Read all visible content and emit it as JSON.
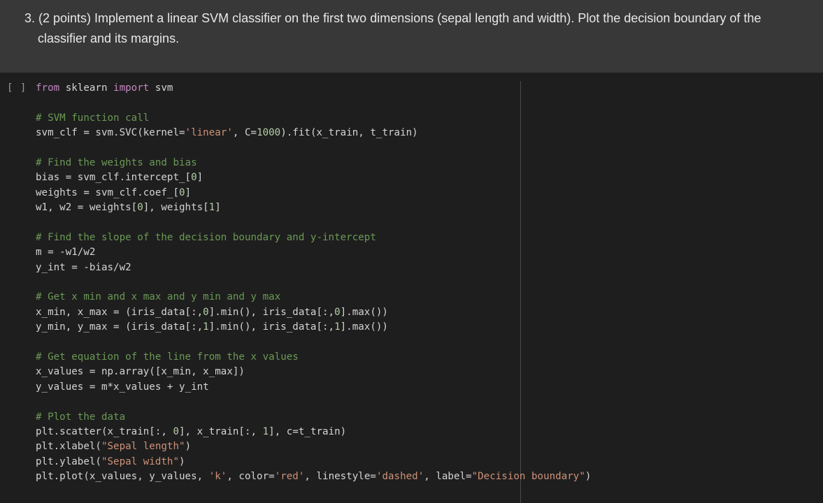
{
  "markdown": {
    "lines": [
      "3. (2 points) Implement a linear SVM classifier on the first two dimensions (sepal length and width). Plot the decision boundary of the",
      "classifier and its margins."
    ]
  },
  "code_cell": {
    "run_indicator": "[ ]",
    "lines": [
      [
        {
          "t": "kw",
          "s": "from"
        },
        {
          "t": "pl",
          "s": " sklearn "
        },
        {
          "t": "kw",
          "s": "import"
        },
        {
          "t": "pl",
          "s": " svm"
        }
      ],
      [],
      [
        {
          "t": "cm",
          "s": "# SVM function call"
        }
      ],
      [
        {
          "t": "pl",
          "s": "svm_clf = svm.SVC(kernel="
        },
        {
          "t": "st",
          "s": "'linear'"
        },
        {
          "t": "pl",
          "s": ", C="
        },
        {
          "t": "nm",
          "s": "1000"
        },
        {
          "t": "pl",
          "s": ").fit(x_train, t_train)"
        }
      ],
      [],
      [
        {
          "t": "cm",
          "s": "# Find the weights and bias"
        }
      ],
      [
        {
          "t": "pl",
          "s": "bias = svm_clf.intercept_["
        },
        {
          "t": "nm",
          "s": "0"
        },
        {
          "t": "pl",
          "s": "]"
        }
      ],
      [
        {
          "t": "pl",
          "s": "weights = svm_clf.coef_["
        },
        {
          "t": "nm",
          "s": "0"
        },
        {
          "t": "pl",
          "s": "]"
        }
      ],
      [
        {
          "t": "pl",
          "s": "w1, w2 = weights["
        },
        {
          "t": "nm",
          "s": "0"
        },
        {
          "t": "pl",
          "s": "], weights["
        },
        {
          "t": "nm",
          "s": "1"
        },
        {
          "t": "pl",
          "s": "]"
        }
      ],
      [],
      [
        {
          "t": "cm",
          "s": "# Find the slope of the decision boundary and y-intercept"
        }
      ],
      [
        {
          "t": "pl",
          "s": "m = -w1/w2"
        }
      ],
      [
        {
          "t": "pl",
          "s": "y_int = -bias/w2"
        }
      ],
      [],
      [
        {
          "t": "cm",
          "s": "# Get x min and x max and y min and y max"
        }
      ],
      [
        {
          "t": "pl",
          "s": "x_min, x_max = (iris_data[:,"
        },
        {
          "t": "nm",
          "s": "0"
        },
        {
          "t": "pl",
          "s": "].min(), iris_data[:,"
        },
        {
          "t": "nm",
          "s": "0"
        },
        {
          "t": "pl",
          "s": "].max())"
        }
      ],
      [
        {
          "t": "pl",
          "s": "y_min, y_max = (iris_data[:,"
        },
        {
          "t": "nm",
          "s": "1"
        },
        {
          "t": "pl",
          "s": "].min(), iris_data[:,"
        },
        {
          "t": "nm",
          "s": "1"
        },
        {
          "t": "pl",
          "s": "].max())"
        }
      ],
      [],
      [
        {
          "t": "cm",
          "s": "# Get equation of the line from the x values"
        }
      ],
      [
        {
          "t": "pl",
          "s": "x_values = np.array([x_min, x_max])"
        }
      ],
      [
        {
          "t": "pl",
          "s": "y_values = m*x_values + y_int"
        }
      ],
      [],
      [
        {
          "t": "cm",
          "s": "# Plot the data"
        }
      ],
      [
        {
          "t": "pl",
          "s": "plt.scatter(x_train[:, "
        },
        {
          "t": "nm",
          "s": "0"
        },
        {
          "t": "pl",
          "s": "], x_train[:, "
        },
        {
          "t": "nm",
          "s": "1"
        },
        {
          "t": "pl",
          "s": "], c=t_train)"
        }
      ],
      [
        {
          "t": "pl",
          "s": "plt.xlabel("
        },
        {
          "t": "st",
          "s": "\"Sepal length\""
        },
        {
          "t": "pl",
          "s": ")"
        }
      ],
      [
        {
          "t": "pl",
          "s": "plt.ylabel("
        },
        {
          "t": "st",
          "s": "\"Sepal width\""
        },
        {
          "t": "pl",
          "s": ")"
        }
      ],
      [
        {
          "t": "pl",
          "s": "plt.plot(x_values, y_values, "
        },
        {
          "t": "st",
          "s": "'k'"
        },
        {
          "t": "pl",
          "s": ", color="
        },
        {
          "t": "st",
          "s": "'red'"
        },
        {
          "t": "pl",
          "s": ", linestyle="
        },
        {
          "t": "st",
          "s": "'dashed'"
        },
        {
          "t": "pl",
          "s": ", label="
        },
        {
          "t": "st",
          "s": "\"Decision boundary\""
        },
        {
          "t": "pl",
          "s": ")"
        }
      ]
    ]
  },
  "colors": {
    "keyword": "#c586c0",
    "comment": "#6a9955",
    "string": "#ce9178",
    "number": "#b5cea8",
    "text": "#d4d4d4",
    "cell_background": "#1e1e1e",
    "markdown_background": "#383838"
  }
}
